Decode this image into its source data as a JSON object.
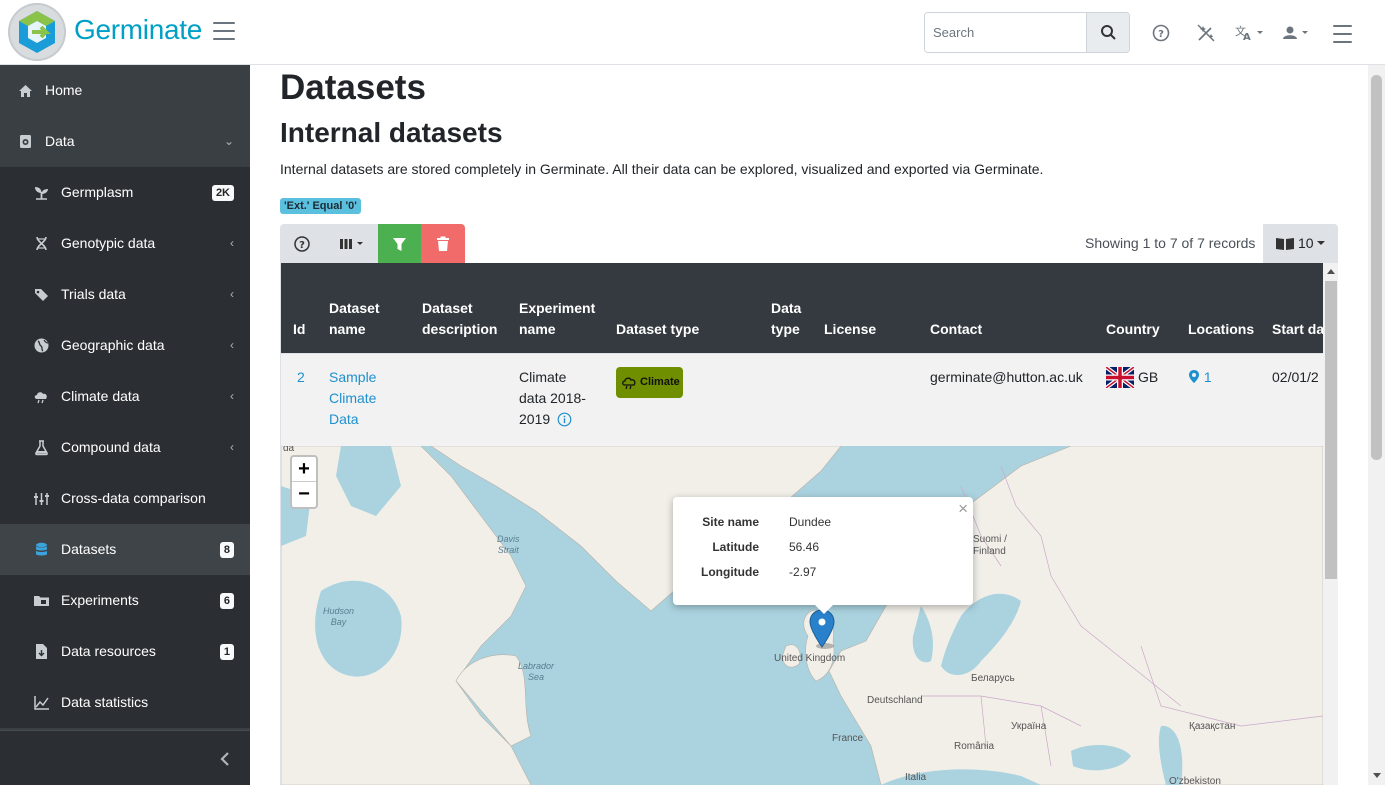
{
  "app": {
    "brand": "Germinate"
  },
  "header": {
    "search_placeholder": "Search"
  },
  "sidebar": {
    "items": [
      {
        "label": "Home",
        "icon": "home-icon"
      },
      {
        "label": "Data",
        "icon": "database-dial-icon"
      },
      {
        "label": "Germplasm",
        "icon": "sprout-icon",
        "badge": "2K"
      },
      {
        "label": "Genotypic data",
        "icon": "dna-icon"
      },
      {
        "label": "Trials data",
        "icon": "tags-icon"
      },
      {
        "label": "Geographic data",
        "icon": "globe-icon"
      },
      {
        "label": "Climate data",
        "icon": "weather-cloud-icon"
      },
      {
        "label": "Compound data",
        "icon": "flask-icon"
      },
      {
        "label": "Cross-data comparison",
        "icon": "tune-icon"
      },
      {
        "label": "Datasets",
        "icon": "database-icon",
        "badge": "8"
      },
      {
        "label": "Experiments",
        "icon": "folder-icon",
        "badge": "6"
      },
      {
        "label": "Data resources",
        "icon": "file-download-icon",
        "badge": "1"
      },
      {
        "label": "Data statistics",
        "icon": "chart-line-icon"
      }
    ]
  },
  "main": {
    "title": "Datasets",
    "subtitle": "Internal datasets",
    "description": "Internal datasets are stored completely in Germinate. All their data can be explored, visualized and exported via Germinate.",
    "filter_badge": "'Ext.' Equal '0'",
    "records": "Showing 1 to 7 of 7 records",
    "per_page": "10"
  },
  "table": {
    "headers": {
      "id": "Id",
      "dataset_name": [
        "Dataset",
        "name"
      ],
      "dataset_description": [
        "Dataset",
        "description"
      ],
      "experiment_name": [
        "Experiment",
        "name"
      ],
      "dataset_type": "Dataset type",
      "data_type": [
        "Data",
        "type"
      ],
      "license": "License",
      "contact": "Contact",
      "country": "Country",
      "locations": "Locations",
      "start_date": "Start da"
    },
    "row": {
      "id": "2",
      "dataset_name": [
        "Sample",
        "Climate",
        "Data"
      ],
      "experiment_name": [
        "Climate",
        "data 2018-",
        "2019"
      ],
      "dataset_type": "Climate",
      "contact": "germinate@hutton.ac.uk",
      "country": "GB",
      "locations": "1",
      "start_date": "02/01/2"
    }
  },
  "map": {
    "labels": {
      "davis": [
        "Davis",
        "Strait"
      ],
      "hudson": [
        "Hudson",
        "Bay"
      ],
      "labrador": [
        "Labrador",
        "Sea"
      ],
      "suomi": [
        "Suomi /",
        "Finland"
      ],
      "uk": "United Kingdom",
      "belarus": "Беларусь",
      "deutschland": "Deutschland",
      "ukraine": "Україна",
      "kazakhstan": "Қазақстан",
      "france": "France",
      "romania": "România",
      "italia": "Italia",
      "ozbekiston": "O'zbekiston",
      "partial": "da"
    },
    "popup": {
      "site_name_label": "Site name",
      "site_name": "Dundee",
      "latitude_label": "Latitude",
      "latitude": "56.46",
      "longitude_label": "Longitude",
      "longitude": "-2.97"
    }
  },
  "colors": {
    "sidebar": "#3a3f44",
    "sidebar_sub": "#2b2f33",
    "table_header": "#343a40",
    "brand": "#00a0c6",
    "filter_green": "#4caf50",
    "delete_red": "#f26b6b",
    "climate_badge": "#708f00",
    "map_water": "#aad3df",
    "link": "#1e90d0"
  }
}
